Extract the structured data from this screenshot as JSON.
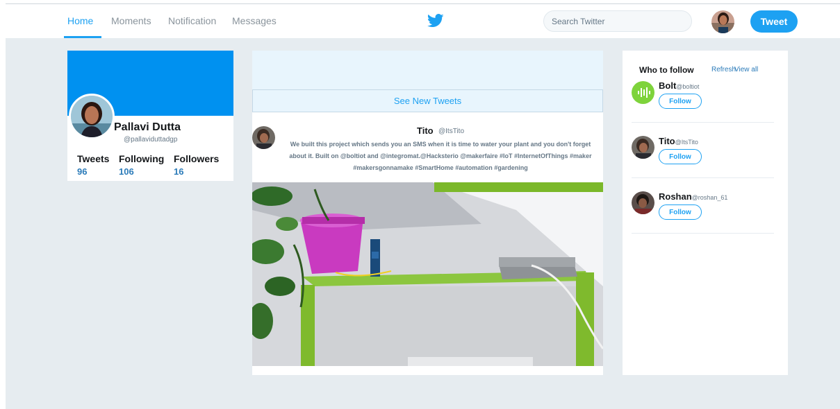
{
  "nav": {
    "tabs": [
      {
        "label": "Home",
        "active": true
      },
      {
        "label": "Moments"
      },
      {
        "label": "Notification"
      },
      {
        "label": "Messages"
      }
    ],
    "logo_icon": "twitter-bird-icon",
    "search_placeholder": "Search Twitter",
    "tweet_label": "Tweet",
    "accent": "#1da1f2"
  },
  "profile": {
    "name": "Pallavi Dutta",
    "handle": "@pallaviduttadgp",
    "banner_color": "#0091f0",
    "stats": [
      {
        "label": "Tweets",
        "value": "96"
      },
      {
        "label": "Following",
        "value": "106"
      },
      {
        "label": "Followers",
        "value": "16"
      }
    ]
  },
  "feed": {
    "new_tweets_label": "See New Tweets",
    "tweet": {
      "name": "Tito",
      "handle": "@ItsTito",
      "text_lines": [
        "We built this project which sends you an SMS when it is time to water your plant and you don't forget",
        "about it. Built on @boltiot and @integromat.@Hacksterio @makerfaire #IoT #InternetOfThings #maker",
        "#makersgonnamake #SmartHome #automation #gardening"
      ]
    }
  },
  "who_to_follow": {
    "title": "Who to follow",
    "refresh_label": "Refresh",
    "view_all_label": "View all",
    "users": [
      {
        "name": "Bolt",
        "handle": "@boltiot",
        "follow_label": "Follow"
      },
      {
        "name": "Tito",
        "handle": "@ItsTito",
        "follow_label": "Follow"
      },
      {
        "name": "Roshan",
        "handle": "@roshan_61",
        "follow_label": "Follow"
      }
    ]
  }
}
